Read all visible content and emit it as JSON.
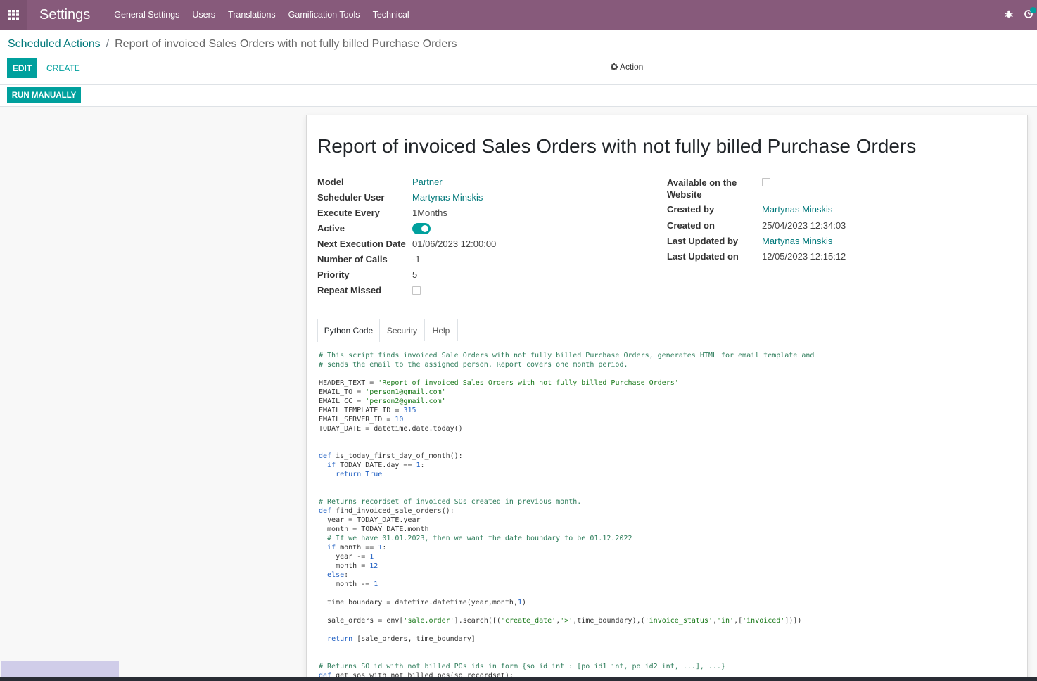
{
  "navbar": {
    "app_title": "Settings",
    "menu": [
      "General Settings",
      "Users",
      "Translations",
      "Gamification Tools",
      "Technical"
    ],
    "icons": [
      "apps-grid-icon",
      "bug-icon",
      "clock-icon"
    ]
  },
  "breadcrumb": {
    "parent": "Scheduled Actions",
    "separator": "/",
    "current": "Report of invoiced Sales Orders with not fully billed Purchase Orders"
  },
  "buttons": {
    "edit": "EDIT",
    "create": "CREATE",
    "action": "Action",
    "run_manually": "RUN MANUALLY"
  },
  "record": {
    "title": "Report of invoiced Sales Orders with not fully billed Purchase Orders",
    "left_fields": [
      {
        "label": "Model",
        "value": "Partner"
      },
      {
        "label": "Scheduler User",
        "value": "Martynas Minskis"
      },
      {
        "label": "Execute Every",
        "value": "1Months"
      },
      {
        "label": "Active",
        "value": "on"
      },
      {
        "label": "Next Execution Date",
        "value": "01/06/2023 12:00:00"
      },
      {
        "label": "Number of Calls",
        "value": "-1"
      },
      {
        "label": "Priority",
        "value": "5"
      },
      {
        "label": "Repeat Missed",
        "value": "unchecked"
      }
    ],
    "right_fields": [
      {
        "label": "Available on the Website",
        "value": "unchecked"
      },
      {
        "label": "Created by",
        "value": "Martynas Minskis"
      },
      {
        "label": "Created on",
        "value": "25/04/2023 12:34:03"
      },
      {
        "label": "Last Updated by",
        "value": "Martynas Minskis"
      },
      {
        "label": "Last Updated on",
        "value": "12/05/2023 12:15:12"
      }
    ]
  },
  "tabs": [
    "Python Code",
    "Security",
    "Help"
  ],
  "code_lines": [
    "# This script finds invoiced Sale Orders with not fully billed Purchase Orders, generates HTML for email template and",
    "# sends the email to the assigned person. Report covers one month period.",
    "",
    "HEADER_TEXT = 'Report of invoiced Sales Orders with not fully billed Purchase Orders'",
    "EMAIL_TO = 'person1@gmail.com'",
    "EMAIL_CC = 'person2@gmail.com'",
    "EMAIL_TEMPLATE_ID = 315",
    "EMAIL_SERVER_ID = 10",
    "TODAY_DATE = datetime.date.today()",
    "",
    "",
    "def is_today_first_day_of_month():",
    "  if TODAY_DATE.day == 1:",
    "    return True",
    "",
    "",
    "# Returns recordset of invoiced SOs created in previous month.",
    "def find_invoiced_sale_orders():",
    "  year = TODAY_DATE.year",
    "  month = TODAY_DATE.month",
    "  # If we have 01.01.2023, then we want the date boundary to be 01.12.2022",
    "  if month == 1:",
    "    year -= 1",
    "    month = 12",
    "  else:",
    "    month -= 1",
    "",
    "  time_boundary = datetime.datetime(year,month,1)",
    "",
    "  sale_orders = env['sale.order'].search([('create_date','>',time_boundary),('invoice_status','in',['invoiced'])])",
    "",
    "  return [sale_orders, time_boundary]",
    "",
    "",
    "# Returns SO id with not billed POs ids in form {so_id_int : [po_id1_int, po_id2_int, ...], ...}",
    "def get_sos_with_not_billed_pos(so_recordset):"
  ],
  "colors": {
    "navbar": "#875a7b",
    "primary": "#00a09d",
    "link": "#00787a"
  }
}
